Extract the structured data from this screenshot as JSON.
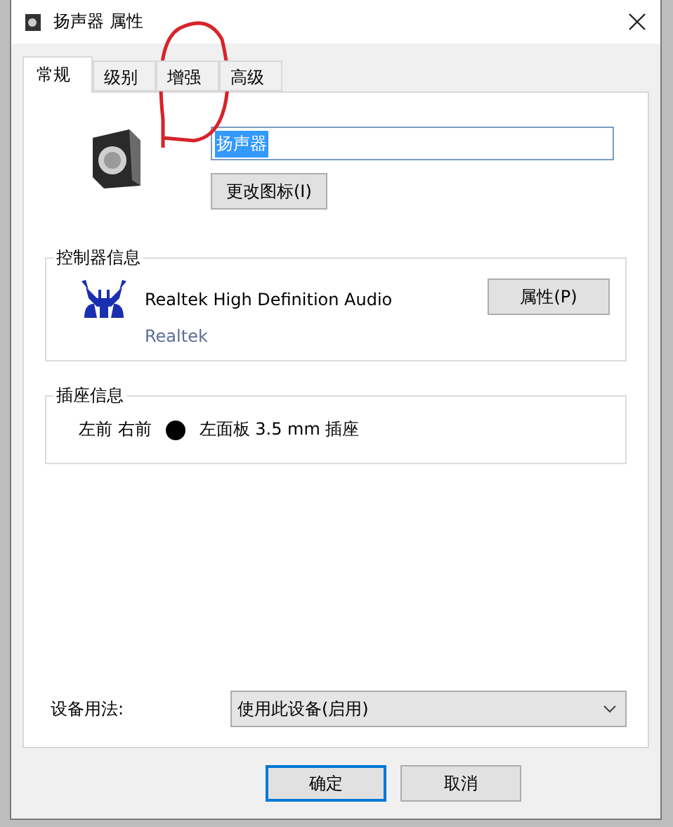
{
  "window": {
    "title": "扬声器 属性"
  },
  "tabs": [
    {
      "label": "常规",
      "selected": true
    },
    {
      "label": "级别",
      "selected": false
    },
    {
      "label": "增强",
      "selected": false
    },
    {
      "label": "高级",
      "selected": false
    }
  ],
  "general": {
    "name_field": {
      "value": "扬声器",
      "text_selected": true
    },
    "change_icon_button": "更改图标(I)"
  },
  "controller": {
    "heading": "控制器信息",
    "name": "Realtek High Definition Audio",
    "vendor_link": "Realtek",
    "properties_button": "属性(P)"
  },
  "jack": {
    "heading": "插座信息",
    "channels": "左前 右前",
    "color": "#000000",
    "description": "左面板 3.5 mm 插座"
  },
  "device_usage": {
    "label": "设备用法:",
    "value": "使用此设备(启用)"
  },
  "buttons": [
    {
      "label": "确定",
      "default": true
    },
    {
      "label": "取消",
      "default": false
    }
  ]
}
